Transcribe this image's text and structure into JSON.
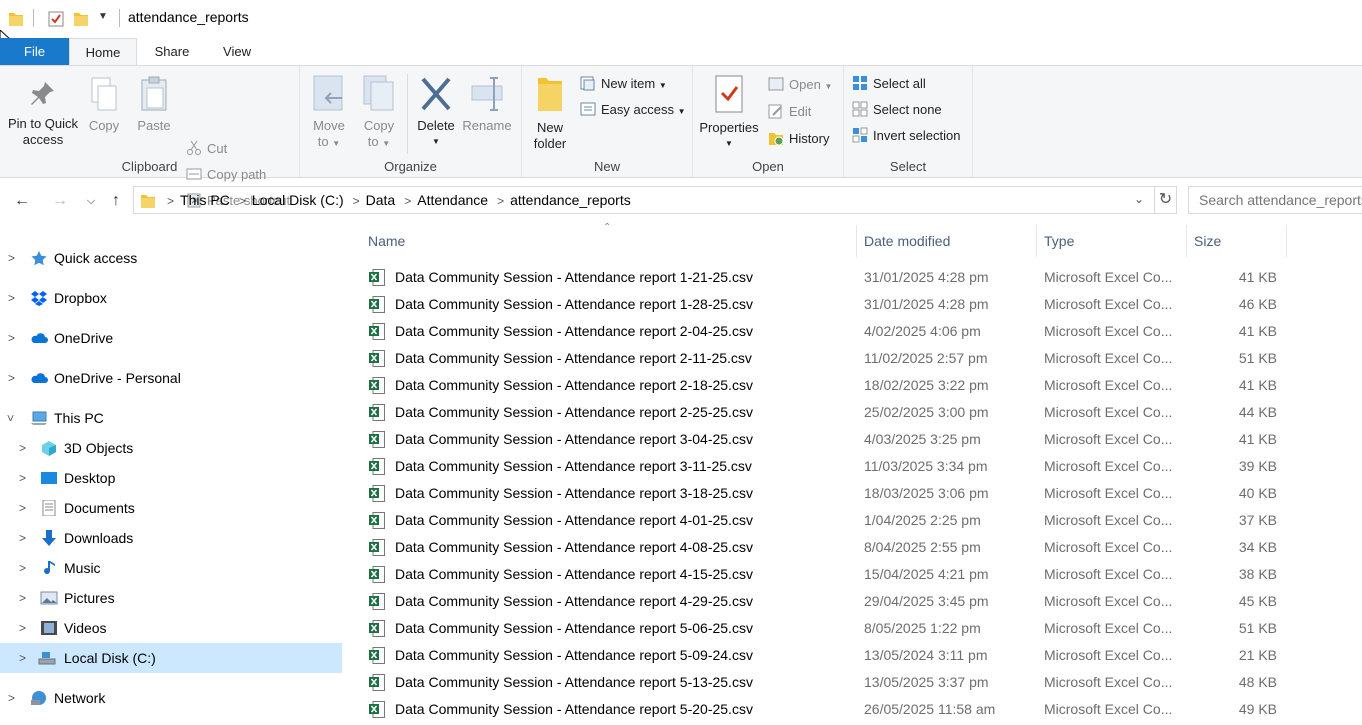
{
  "window": {
    "title": "attendance_reports"
  },
  "tabs": {
    "file": "File",
    "home": "Home",
    "share": "Share",
    "view": "View"
  },
  "ribbon": {
    "clipboard": {
      "label": "Clipboard",
      "pin": "Pin to Quick access",
      "pin1": "Pin to Quick",
      "pin2": "access",
      "copy": "Copy",
      "paste": "Paste",
      "cut": "Cut",
      "copy_path": "Copy path",
      "paste_shortcut": "Paste shortcut"
    },
    "organize": {
      "label": "Organize",
      "move1": "Move",
      "move2": "to",
      "copy1": "Copy",
      "copy2": "to",
      "delete": "Delete",
      "rename": "Rename"
    },
    "new": {
      "label": "New",
      "folder1": "New",
      "folder2": "folder",
      "new_item": "New item",
      "easy_access": "Easy access"
    },
    "open": {
      "label": "Open",
      "properties": "Properties",
      "open": "Open",
      "edit": "Edit",
      "history": "History"
    },
    "select": {
      "label": "Select",
      "select_all": "Select all",
      "select_none": "Select none",
      "invert": "Invert selection"
    }
  },
  "address": {
    "crumbs": [
      "This PC",
      "Local Disk (C:)",
      "Data",
      "Attendance",
      "attendance_reports"
    ],
    "search_placeholder": "Search attendance_reports"
  },
  "nav": {
    "quick_access": "Quick access",
    "dropbox": "Dropbox",
    "onedrive": "OneDrive",
    "onedrive_personal": "OneDrive - Personal",
    "this_pc": "This PC",
    "objects3d": "3D Objects",
    "desktop": "Desktop",
    "documents": "Documents",
    "downloads": "Downloads",
    "music": "Music",
    "pictures": "Pictures",
    "videos": "Videos",
    "local_disk": "Local Disk (C:)",
    "network": "Network"
  },
  "columns": {
    "name": "Name",
    "date": "Date modified",
    "type": "Type",
    "size": "Size"
  },
  "files": [
    {
      "name": "Data Community Session - Attendance report 1-21-25.csv",
      "date": "31/01/2025 4:28 pm",
      "type": "Microsoft Excel Co...",
      "size": "41 KB"
    },
    {
      "name": "Data Community Session - Attendance report 1-28-25.csv",
      "date": "31/01/2025 4:28 pm",
      "type": "Microsoft Excel Co...",
      "size": "46 KB"
    },
    {
      "name": "Data Community Session - Attendance report 2-04-25.csv",
      "date": "4/02/2025 4:06 pm",
      "type": "Microsoft Excel Co...",
      "size": "41 KB"
    },
    {
      "name": "Data Community Session - Attendance report 2-11-25.csv",
      "date": "11/02/2025 2:57 pm",
      "type": "Microsoft Excel Co...",
      "size": "51 KB"
    },
    {
      "name": "Data Community Session - Attendance report 2-18-25.csv",
      "date": "18/02/2025 3:22 pm",
      "type": "Microsoft Excel Co...",
      "size": "41 KB"
    },
    {
      "name": "Data Community Session - Attendance report 2-25-25.csv",
      "date": "25/02/2025 3:00 pm",
      "type": "Microsoft Excel Co...",
      "size": "44 KB"
    },
    {
      "name": "Data Community Session - Attendance report 3-04-25.csv",
      "date": "4/03/2025 3:25 pm",
      "type": "Microsoft Excel Co...",
      "size": "41 KB"
    },
    {
      "name": "Data Community Session - Attendance report 3-11-25.csv",
      "date": "11/03/2025 3:34 pm",
      "type": "Microsoft Excel Co...",
      "size": "39 KB"
    },
    {
      "name": "Data Community Session - Attendance report 3-18-25.csv",
      "date": "18/03/2025 3:06 pm",
      "type": "Microsoft Excel Co...",
      "size": "40 KB"
    },
    {
      "name": "Data Community Session - Attendance report 4-01-25.csv",
      "date": "1/04/2025 2:25 pm",
      "type": "Microsoft Excel Co...",
      "size": "37 KB"
    },
    {
      "name": "Data Community Session - Attendance report 4-08-25.csv",
      "date": "8/04/2025 2:55 pm",
      "type": "Microsoft Excel Co...",
      "size": "34 KB"
    },
    {
      "name": "Data Community Session - Attendance report 4-15-25.csv",
      "date": "15/04/2025 4:21 pm",
      "type": "Microsoft Excel Co...",
      "size": "38 KB"
    },
    {
      "name": "Data Community Session - Attendance report 4-29-25.csv",
      "date": "29/04/2025 3:45 pm",
      "type": "Microsoft Excel Co...",
      "size": "45 KB"
    },
    {
      "name": "Data Community Session - Attendance report 5-06-25.csv",
      "date": "8/05/2025 1:22 pm",
      "type": "Microsoft Excel Co...",
      "size": "51 KB"
    },
    {
      "name": "Data Community Session - Attendance report 5-09-24.csv",
      "date": "13/05/2024 3:11 pm",
      "type": "Microsoft Excel Co...",
      "size": "21 KB"
    },
    {
      "name": "Data Community Session - Attendance report 5-13-25.csv",
      "date": "13/05/2025 3:37 pm",
      "type": "Microsoft Excel Co...",
      "size": "48 KB"
    },
    {
      "name": "Data Community Session - Attendance report 5-20-25.csv",
      "date": "26/05/2025 11:58 am",
      "type": "Microsoft Excel Co...",
      "size": "49 KB"
    }
  ],
  "colors": {
    "accent": "#1979ca",
    "selection": "#cce8ff",
    "excel": "#1d6f42"
  }
}
